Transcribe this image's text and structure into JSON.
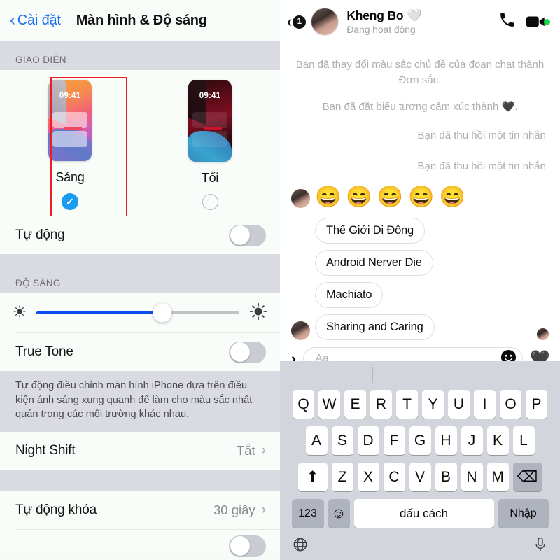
{
  "settings": {
    "back_label": "Cài đặt",
    "title": "Màn hình & Độ sáng",
    "section_appearance": "GIAO DIỆN",
    "appearance": {
      "light": {
        "label": "Sáng",
        "time": "09:41",
        "selected": true,
        "check": "✓"
      },
      "dark": {
        "label": "Tối",
        "time": "09:41",
        "selected": false
      }
    },
    "auto_row": {
      "label": "Tự động",
      "value": "off"
    },
    "section_brightness": "ĐỘ SÁNG",
    "brightness": {
      "percent": 62
    },
    "true_tone": {
      "label": "True Tone",
      "value": "off"
    },
    "true_tone_note": "Tự động điều chỉnh màn hình iPhone dựa trên điều kiện ánh sáng xung quanh để làm cho màu sắc nhất quán trong các môi trường khác nhau.",
    "night_shift": {
      "label": "Night Shift",
      "value": "Tắt",
      "chevron": "›"
    },
    "auto_lock": {
      "label": "Tự động khóa",
      "value": "30 giây",
      "chevron": "›"
    },
    "accent_color": "#1b6ef3",
    "highlight_color": "#ee1c25"
  },
  "messenger": {
    "header": {
      "back": "‹",
      "unread_badge": "1",
      "name": "Kheng Bo",
      "name_emoji": "🤍",
      "status": "Đang hoạt động",
      "call_icon": "phone-icon",
      "video_icon": "video-icon",
      "active_dot_color": "#18d94a"
    },
    "system_messages": [
      {
        "text": "Bạn đã thay đổi màu sắc chủ đề của đoạn chat thành Đơn sắc.",
        "align": "center"
      },
      {
        "text": "Bạn đã đặt biểu tượng cảm xúc thành 🖤.",
        "align": "center"
      },
      {
        "text": "Bạn đã thu hồi một tin nhắn",
        "align": "right"
      },
      {
        "text": "Bạn đã thu hồi một tin nhắn",
        "align": "right"
      }
    ],
    "emoji_reactions": [
      "😄",
      "😄",
      "😄",
      "😄",
      "😄"
    ],
    "bubbles": [
      "Thế Giới Di Động",
      "Android Nerver Die",
      "Machiato",
      "Sharing and Caring"
    ],
    "composer": {
      "expand": "›",
      "placeholder": "Aa",
      "emoji_icon": "😃",
      "like_emoji": "🖤"
    },
    "keyboard": {
      "row1": [
        "Q",
        "W",
        "E",
        "R",
        "T",
        "Y",
        "U",
        "I",
        "O",
        "P"
      ],
      "row2": [
        "A",
        "S",
        "D",
        "F",
        "G",
        "H",
        "J",
        "K",
        "L"
      ],
      "row3": [
        "Z",
        "X",
        "C",
        "V",
        "B",
        "N",
        "M"
      ],
      "shift": "⬆",
      "backspace": "⌫",
      "numbers": "123",
      "emoji_key": "☺",
      "space": "dấu cách",
      "enter": "Nhập",
      "globe": "🌐",
      "mic": "🎤"
    }
  }
}
